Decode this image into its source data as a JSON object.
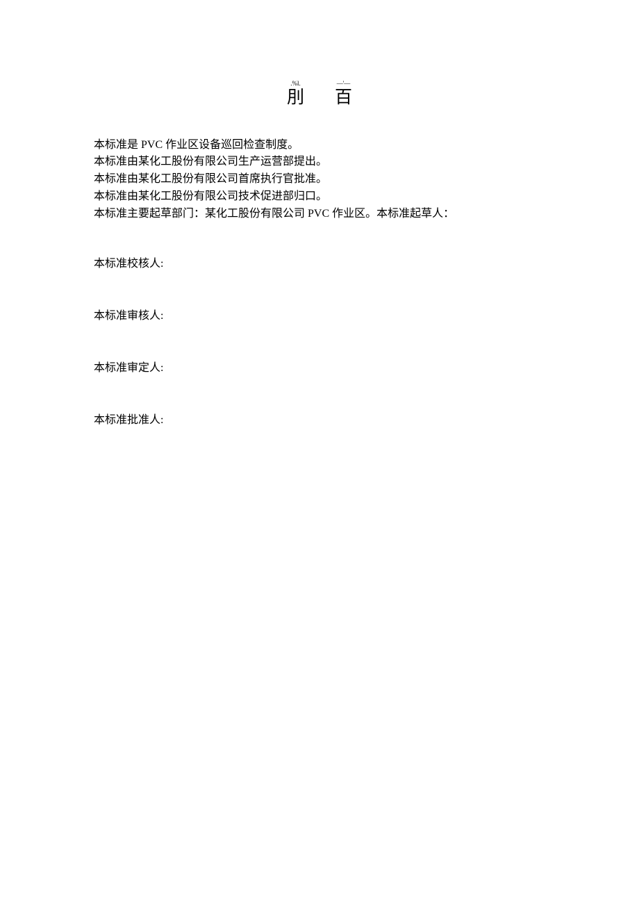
{
  "title": {
    "char1_anno": ".%l.",
    "char1": "刖",
    "char2_anno": "—'—",
    "char2": "百"
  },
  "paragraphs": {
    "p1": "本标准是 PVC 作业区设备巡回检查制度。",
    "p2": "本标准由某化工股份有限公司生产运营部提出。",
    "p3": "本标准由某化工股份有限公司首席执行官批准。",
    "p4": "本标准由某化工股份有限公司技术促进部归口。",
    "p5": "本标准主要起草部门：某化工股份有限公司 PVC 作业区。本标准起草人：",
    "p6": "本标准校核人:",
    "p7": "本标准审核人:",
    "p8": "本标准审定人:",
    "p9": "本标准批准人:"
  }
}
